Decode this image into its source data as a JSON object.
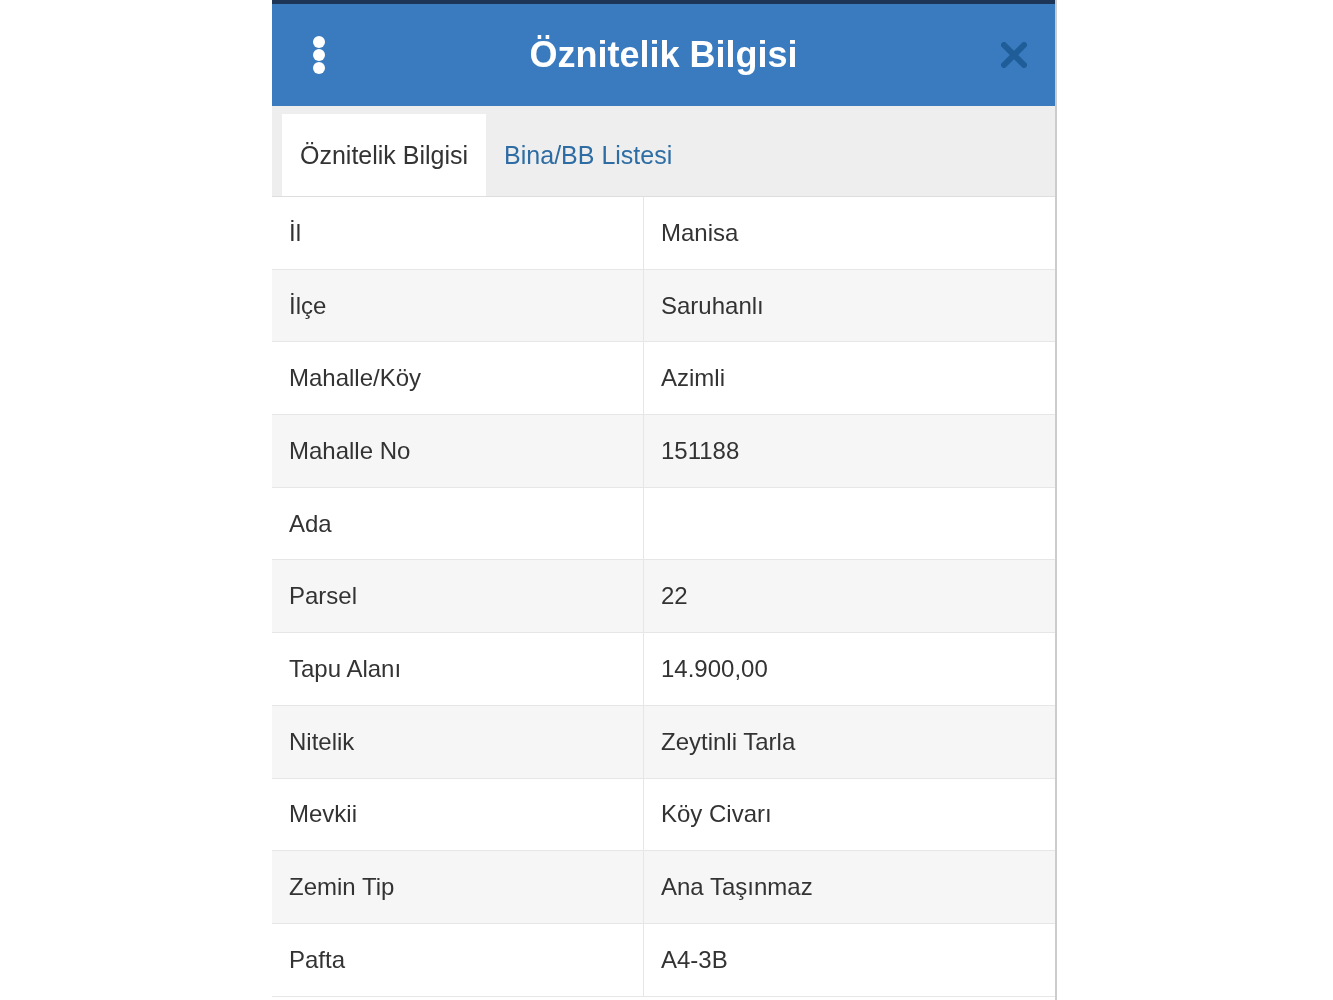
{
  "header": {
    "title": "Öznitelik Bilgisi"
  },
  "tabs": [
    {
      "label": "Öznitelik Bilgisi",
      "selected": true
    },
    {
      "label": "Bina/BB Listesi",
      "selected": false
    }
  ],
  "rows": [
    {
      "label": "İl",
      "value": "Manisa"
    },
    {
      "label": "İlçe",
      "value": "Saruhanlı"
    },
    {
      "label": "Mahalle/Köy",
      "value": "Azimli"
    },
    {
      "label": "Mahalle No",
      "value": "151188"
    },
    {
      "label": "Ada"
    },
    {
      "label": "Parsel",
      "value": "22"
    },
    {
      "label": "Tapu Alanı",
      "value": "14.900,00"
    },
    {
      "label": "Nitelik",
      "value": "Zeytinli Tarla"
    },
    {
      "label": "Mevkii",
      "value": "Köy Civarı"
    },
    {
      "label": "Zemin Tip",
      "value": "Ana Taşınmaz"
    },
    {
      "label": "Pafta",
      "value": "A4-3B"
    }
  ]
}
